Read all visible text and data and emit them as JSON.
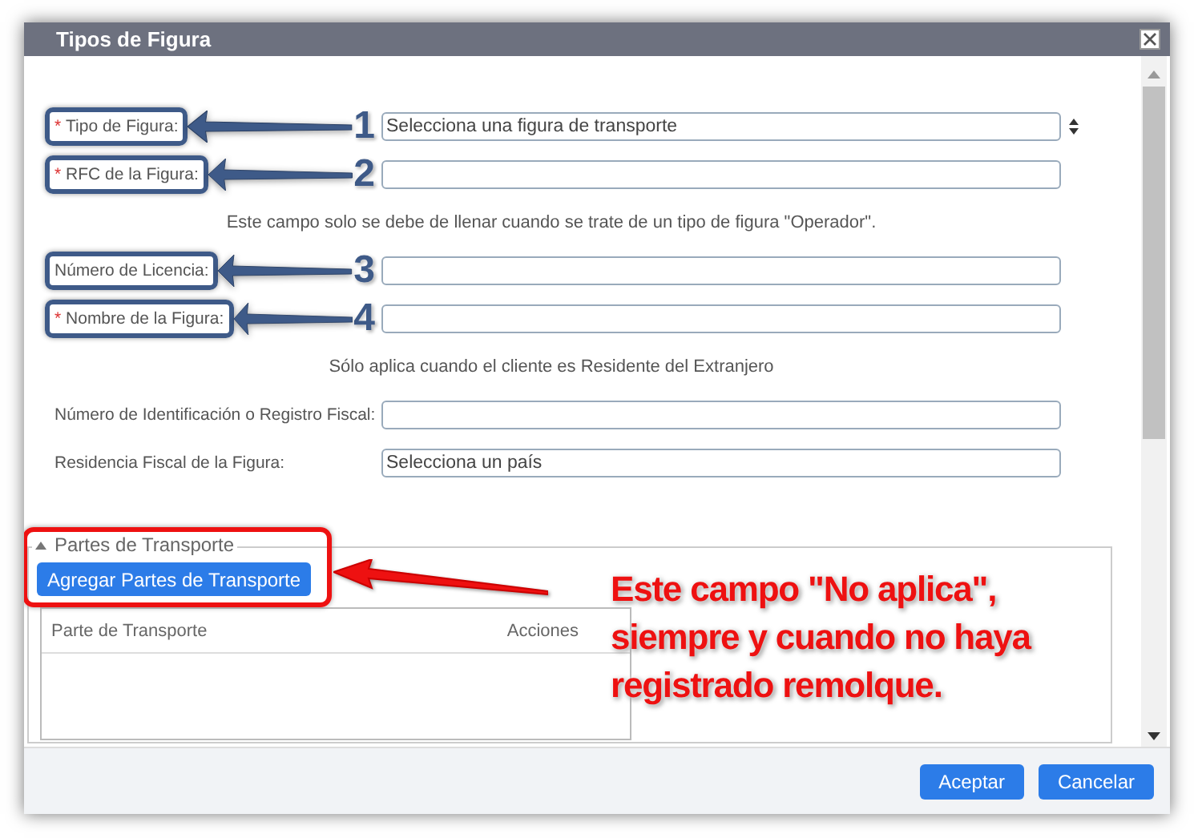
{
  "window": {
    "title": "Tipos de Figura"
  },
  "form": [
    {
      "kind": "select",
      "label": "Tipo de Figura:",
      "marker": "*",
      "placeholder": "Selecciona una figura de transporte",
      "callout": "1"
    },
    {
      "kind": "text",
      "label": "RFC de la Figura:",
      "marker": "*",
      "callout": "2"
    },
    {
      "kind": "note",
      "text": "Este campo solo se debe de llenar cuando se trate de un tipo de figura \"Operador\"."
    },
    {
      "kind": "text",
      "label": "Número de Licencia:",
      "callout": "3"
    },
    {
      "kind": "text",
      "label": "Nombre de la Figura:",
      "marker": "*",
      "callout": "4"
    },
    {
      "kind": "note",
      "text": "Sólo aplica cuando el cliente es Residente del Extranjero"
    },
    {
      "kind": "text",
      "label": "Número de Identificación o Registro Fiscal:"
    },
    {
      "kind": "text",
      "label": "Residencia Fiscal de la Figura:",
      "placeholder": "Selecciona un país"
    }
  ],
  "parts_section": {
    "legend": "Partes de Transporte",
    "expanded": true,
    "button": "Agregar Partes de Transporte",
    "columns": [
      "Parte de Transporte",
      "Acciones"
    ],
    "annotation": "Este campo \"No aplica\",\nsiempre y cuando no haya\nregistrado remolque."
  },
  "buttons": [
    "Aceptar",
    "Cancelar"
  ]
}
